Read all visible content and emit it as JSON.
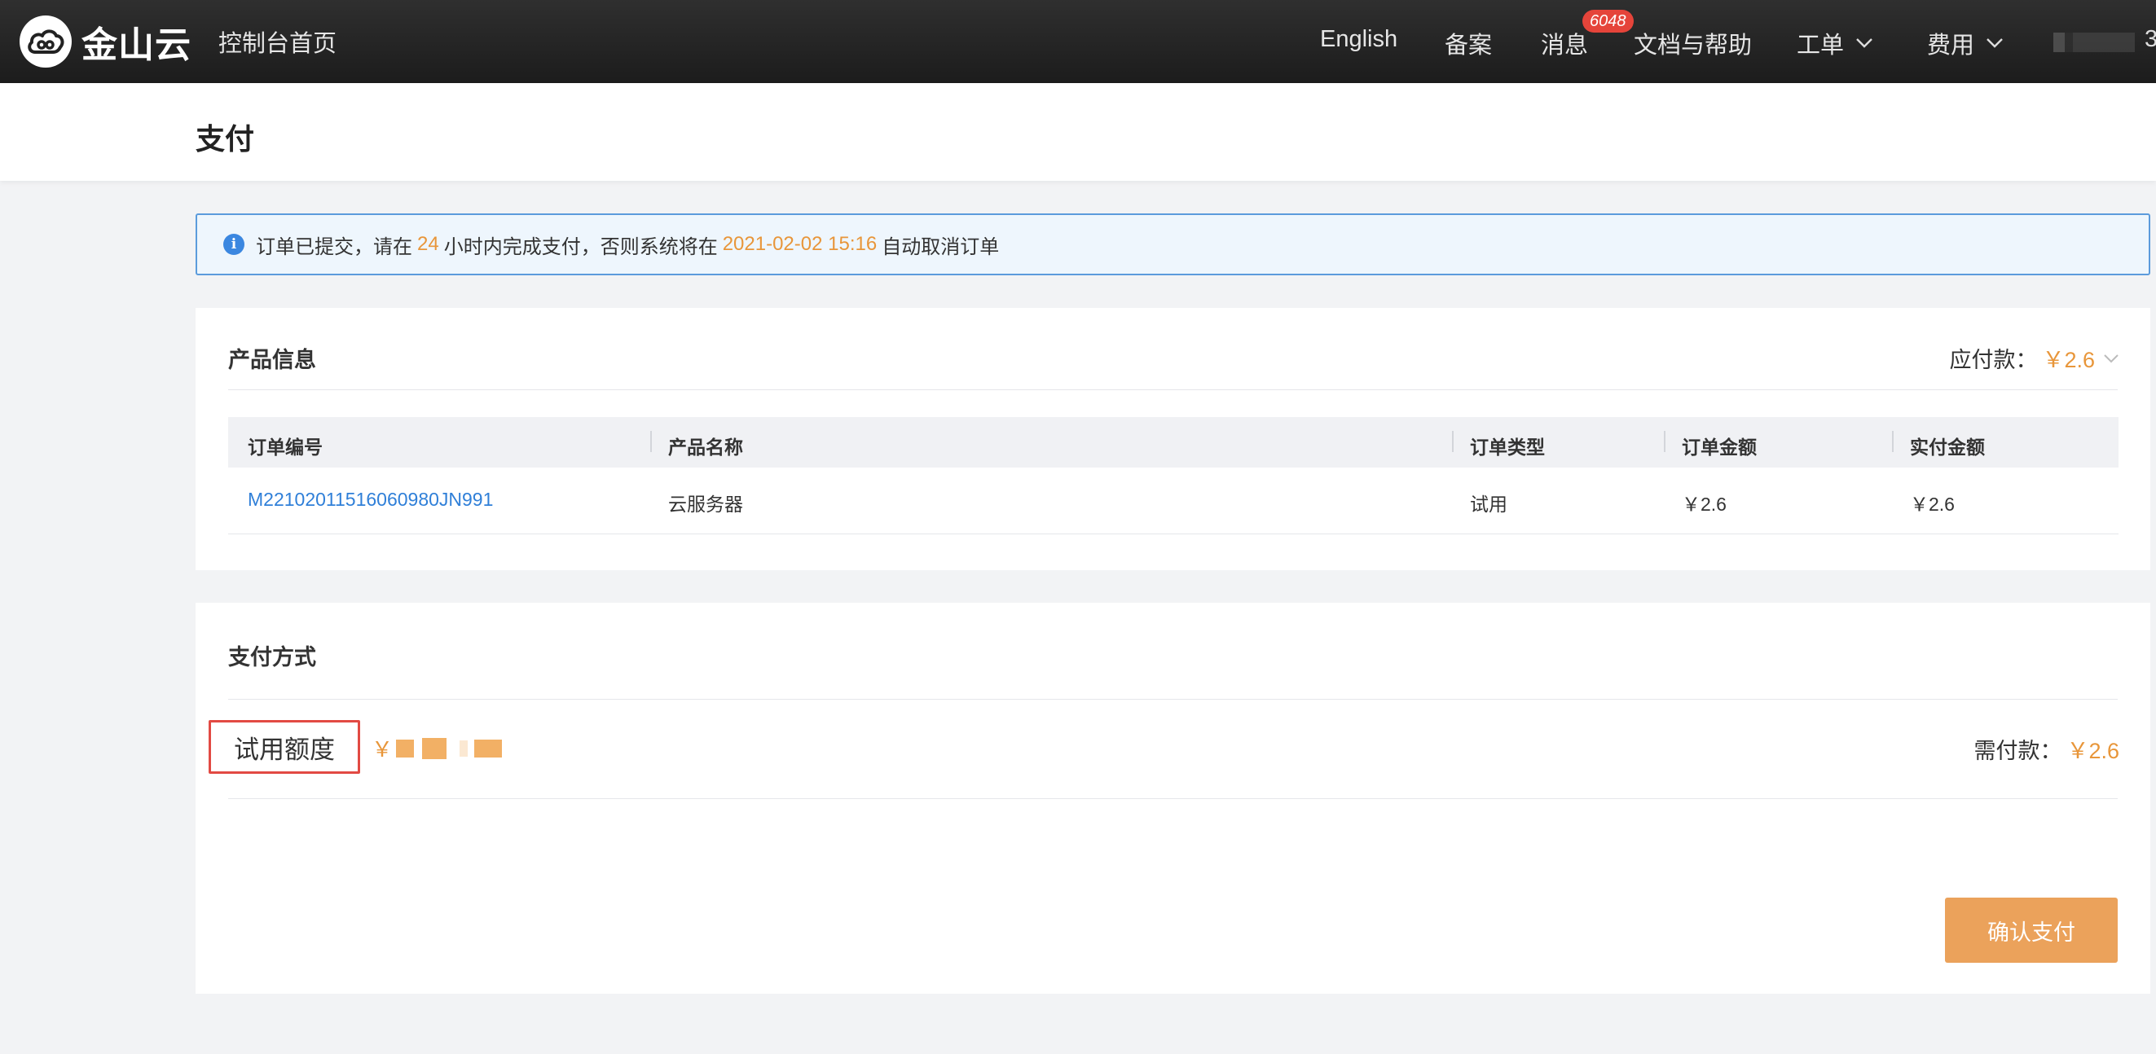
{
  "topbar": {
    "logo_text": "金山云",
    "console_home": "控制台首页",
    "nav": {
      "english": "English",
      "filing": "备案",
      "messages": "消息",
      "messages_badge": "6048",
      "docs": "文档与帮助",
      "tickets": "工单",
      "billing": "费用"
    },
    "user_suffix": "3"
  },
  "page": {
    "title": "支付"
  },
  "alert": {
    "part1": "订单已提交，请在",
    "hours": "24",
    "part2": "小时内完成支付，否则系统将在",
    "deadline": "2021-02-02 15:16",
    "part3": "自动取消订单"
  },
  "product": {
    "title": "产品信息",
    "due_label": "应付款：",
    "due_amount": "￥2.6",
    "columns": [
      "订单编号",
      "产品名称",
      "订单类型",
      "订单金额",
      "实付金额"
    ],
    "rows": [
      {
        "order_no": "M22102011516060980JN991",
        "product": "云服务器",
        "type": "试用",
        "amount": "￥2.6",
        "paid": "￥2.6"
      }
    ]
  },
  "payment": {
    "title": "支付方式",
    "method_label": "试用额度",
    "currency": "￥",
    "need_label": "需付款：",
    "need_amount": "￥2.6",
    "confirm_label": "确认支付"
  },
  "colors": {
    "accent_orange": "#e8963a",
    "link_blue": "#2f7fd8",
    "alert_border": "#5b9bdc",
    "highlight_red": "#e24a43",
    "topbar": "#262626"
  }
}
